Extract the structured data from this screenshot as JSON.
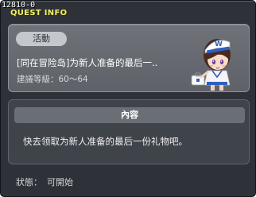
{
  "debug_id": "12810-0",
  "window": {
    "title": "QUEST INFO"
  },
  "quest": {
    "tag": "活動",
    "name": "[同在冒险岛]为新人准备的最后一..",
    "level": "建議等級：60〜64"
  },
  "npc": {
    "icon": "npc-girl-portrait-icon",
    "hat_letter": "W"
  },
  "content": {
    "header": "內容",
    "text": "快去领取为新人准备的最后一份礼物吧。"
  },
  "status": {
    "label": "狀態：",
    "value": "可開始"
  },
  "colors": {
    "window_bg": "#2e3238",
    "title": "#f1f06a",
    "top_panel": "#666a70",
    "content_header": "#6a6f76"
  }
}
